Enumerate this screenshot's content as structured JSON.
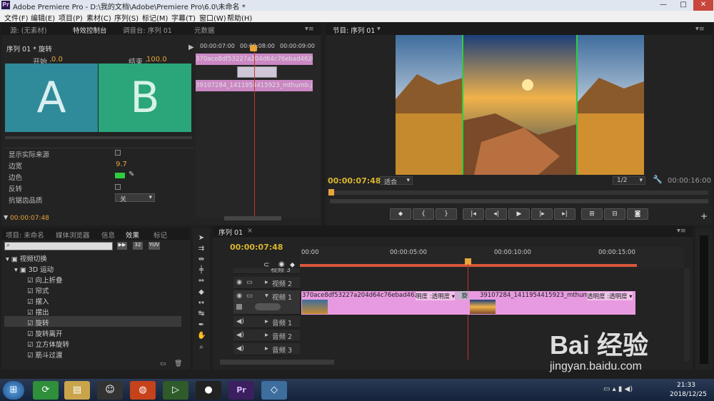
{
  "window": {
    "title": "Adobe Premiere Pro - D:\\我的文档\\Adobe\\Premiere Pro\\6.0\\未命名 *",
    "logo": "Pr"
  },
  "menu": [
    "文件(F)",
    "编辑(E)",
    "项目(P)",
    "素材(C)",
    "序列(S)",
    "标记(M)",
    "字幕(T)",
    "窗口(W)",
    "帮助(H)"
  ],
  "source_panel": {
    "tabs": [
      "源: (无素材)",
      "特效控制台",
      "调音台: 序列 01",
      "元数据"
    ],
    "sequence_label": "序列 01 * 旋转",
    "start_label": "开始 :",
    "start_value": "0.0",
    "end_label": "结束 :",
    "end_value": "100.0",
    "preview_a": "A",
    "preview_b": "B",
    "ruler": [
      "00:00:07:00",
      "00:00:08:00",
      "00:00:09:00"
    ],
    "clip_top": "370ace8df53227a204d64c76ebad4620.jpg",
    "clip_bottom": "39107284_1411954415923_mthumb.jpg",
    "props": [
      {
        "label": "显示实际来源",
        "type": "checkbox"
      },
      {
        "label": "边宽",
        "value": "9.7"
      },
      {
        "label": "边色",
        "type": "color",
        "color": "#2ecc40"
      },
      {
        "label": "反转",
        "type": "checkbox"
      },
      {
        "label": "抗锯齿品质",
        "value": "关"
      }
    ],
    "timecode": "00:00:07:48"
  },
  "program_panel": {
    "tab": "节目: 序列 01",
    "timecode": "00:00:07:48",
    "fit": "适合",
    "quality": "1/2",
    "duration": "00:00:16:00"
  },
  "project_panel": {
    "tabs": [
      "项目: 未命名",
      "媒体浏览器",
      "信息",
      "效果",
      "标记"
    ],
    "badges": [
      "32",
      "YUV"
    ],
    "tree": [
      {
        "label": "视频切换",
        "level": 0
      },
      {
        "label": "3D 运动",
        "level": 1
      },
      {
        "label": "向上折叠",
        "level": 2
      },
      {
        "label": "帘式",
        "level": 2
      },
      {
        "label": "摆入",
        "level": 2
      },
      {
        "label": "摆出",
        "level": 2
      },
      {
        "label": "旋转",
        "level": 2
      },
      {
        "label": "旋转离开",
        "level": 2
      },
      {
        "label": "立方体旋转",
        "level": 2
      },
      {
        "label": "筋斗过渡",
        "level": 2
      }
    ]
  },
  "timeline": {
    "tab": "序列 01",
    "timecode": "00:00:07:48",
    "ruler": [
      "00:00",
      "00:00:05:00",
      "00:00:10:00",
      "00:00:15:00"
    ],
    "tracks": [
      {
        "name": "视频 3",
        "kind": "video"
      },
      {
        "name": "视频 2",
        "kind": "video"
      },
      {
        "name": "视频 1",
        "kind": "video"
      },
      {
        "name": "音频 1",
        "kind": "audio"
      },
      {
        "name": "音频 2",
        "kind": "audio"
      },
      {
        "name": "音频 3",
        "kind": "audio"
      }
    ],
    "clip1": {
      "name": "370ace8df53227a204d64c76ebad4620.jpg",
      "fx": "明度 :透明度 ▾"
    },
    "transition": "旋转",
    "clip2": {
      "name": "39107284_1411954415923_mthumb.jpg",
      "fx": "透明度 :透明度 ▾"
    }
  },
  "watermark": {
    "brand": "Bai 经验",
    "url": "jingyan.baidu.com"
  },
  "taskbar": {
    "time": "21:33",
    "date": "2018/12/25"
  }
}
